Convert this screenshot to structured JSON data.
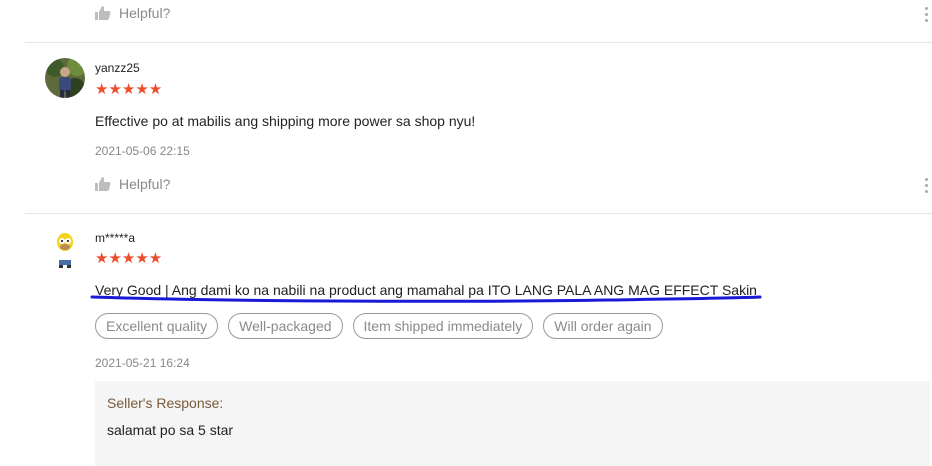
{
  "reviews": [
    {
      "helpful_label": "Helpful?"
    },
    {
      "username": "yanzz25",
      "rating": 5,
      "stars": "★★★★★",
      "text": "Effective po at mabilis ang shipping more power sa shop nyu!",
      "date": "2021-05-06 22:15",
      "helpful_label": "Helpful?"
    },
    {
      "username": "m*****a",
      "rating": 5,
      "stars": "★★★★★",
      "text": "Very Good | Ang dami ko na nabili na product ang mamahal pa ITO LANG PALA ANG MAG EFFECT Sakin",
      "tags": [
        "Excellent quality",
        "Well-packaged",
        "Item shipped immediately",
        "Will order again"
      ],
      "date": "2021-05-21 16:24",
      "seller_response": {
        "label": "Seller's Response:",
        "text": "salamat po sa 5 star"
      }
    }
  ],
  "colors": {
    "star": "#ee4d2d",
    "annotation_underline": "#1a1ad6",
    "response_bg": "#f5f5f5"
  },
  "icons": [
    "thumbs-up-icon",
    "more-vertical-icon"
  ]
}
